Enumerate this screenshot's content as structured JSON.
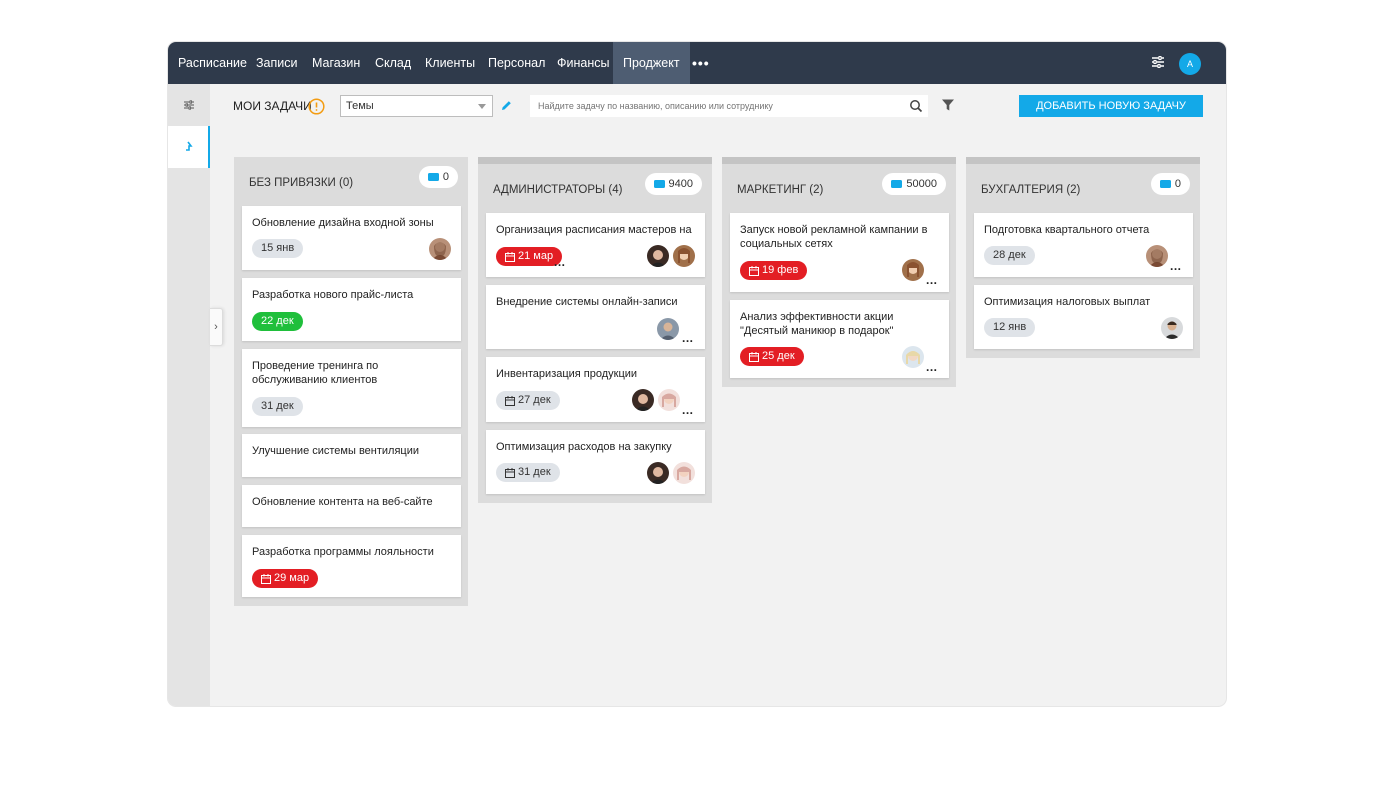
{
  "nav": {
    "items": [
      "Расписание",
      "Записи",
      "Магазин",
      "Склад",
      "Клиенты",
      "Персонал",
      "Финансы",
      "Проджект"
    ],
    "more": "•••",
    "avatar_initial": "A"
  },
  "toolbar": {
    "title": "МОИ ЗАДАЧИ",
    "theme_value": "Темы",
    "search_placeholder": "Найдите задачу по названию, описанию или сотруднику",
    "add_label": "ДОБАВИТЬ НОВУЮ ЗАДАЧУ"
  },
  "colors": {
    "accent": "#13a9e8",
    "nav_bg": "#2f3a4b",
    "overdue": "#e31e24",
    "done": "#1fbf3b"
  },
  "columns": [
    {
      "title": "БЕЗ ПРИВЯЗКИ (0)",
      "budget": "0",
      "cards": [
        {
          "title": "Обновление дизайна входной зоны",
          "date": "15 янв",
          "status": "grey"
        },
        {
          "title": "Разработка нового прайс-листа",
          "date": "22 дек",
          "status": "green"
        },
        {
          "title": "Проведение тренинга по обслуживанию клиентов",
          "date": "31 дек",
          "status": "grey"
        },
        {
          "title": "Улучшение системы вентиляции"
        },
        {
          "title": "Обновление контента на веб-сайте"
        },
        {
          "title": "Разработка программы лояльности",
          "date": "29 мар",
          "status": "red"
        }
      ]
    },
    {
      "title": "АДМИНИСТРАТОРЫ (4)",
      "budget": "9400",
      "cards": [
        {
          "title": "Организация расписания мастеров на",
          "date": "21 мар",
          "status": "red"
        },
        {
          "title": "Внедрение системы онлайн-записи"
        },
        {
          "title": "Инвентаризация продукции",
          "date": "27 дек",
          "status": "grey"
        },
        {
          "title": "Оптимизация расходов на закупку",
          "date": "31 дек",
          "status": "grey"
        }
      ]
    },
    {
      "title": "МАРКЕТИНГ (2)",
      "budget": "50000",
      "cards": [
        {
          "title": "Запуск новой рекламной кампании в социальных сетях",
          "date": "19 фев",
          "status": "red"
        },
        {
          "title": "Анализ эффективности акции \"Десятый маникюр в подарок\"",
          "date": "25 дек",
          "status": "red"
        }
      ]
    },
    {
      "title": "БУХГАЛТЕРИЯ (2)",
      "budget": "0",
      "cards": [
        {
          "title": "Подготовка квартального отчета",
          "date": "28 дек",
          "status": "grey"
        },
        {
          "title": "Оптимизация налоговых выплат",
          "date": "12 янв",
          "status": "grey"
        }
      ]
    }
  ],
  "more_dots": "..."
}
